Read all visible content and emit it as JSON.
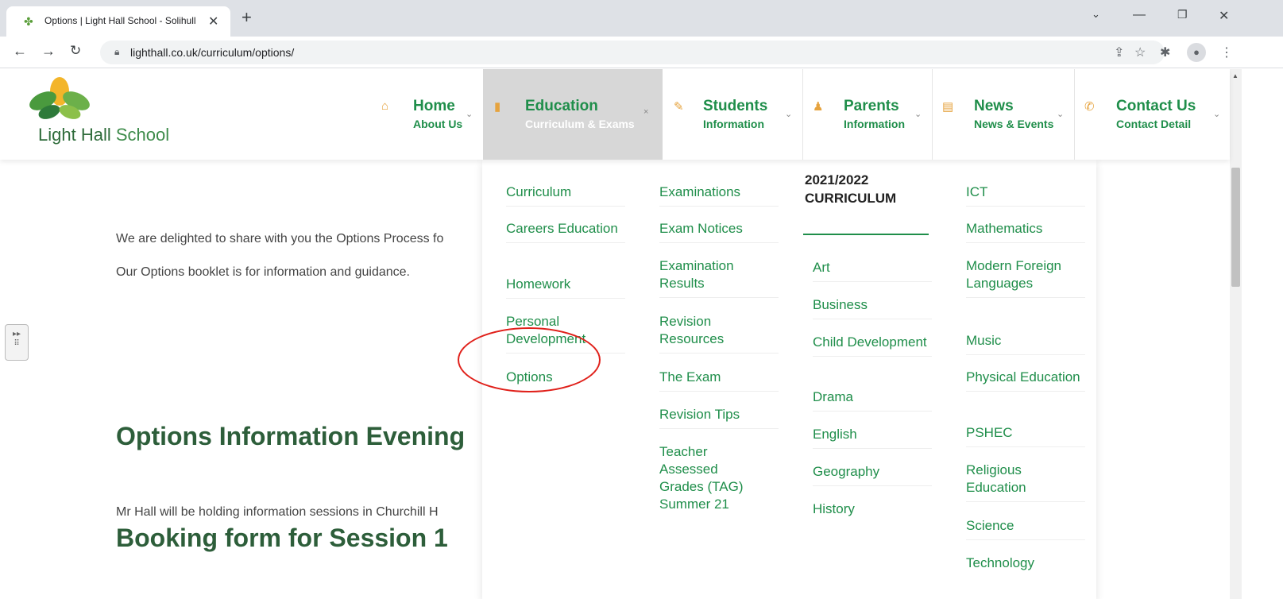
{
  "browser": {
    "tab_title": "Options | Light Hall School - Solihull",
    "url": "lighthall.co.uk/curriculum/options/"
  },
  "logo": {
    "light": "Light",
    "hall": " Hall ",
    "school": "School"
  },
  "nav": [
    {
      "title": "Home",
      "sub": "About Us",
      "icon": "home-icon"
    },
    {
      "title": "Education",
      "sub": "Curriculum & Exams",
      "icon": "book-icon"
    },
    {
      "title": "Students",
      "sub": "Information",
      "icon": "pencil-icon"
    },
    {
      "title": "Parents",
      "sub": "Information",
      "icon": "person-icon"
    },
    {
      "title": "News",
      "sub": "News & Events",
      "icon": "document-icon"
    },
    {
      "title": "Contact Us",
      "sub": "Contact Detail",
      "icon": "phone-icon"
    }
  ],
  "content": {
    "intro1": "We are delighted to share with you the Options Process fo",
    "intro2": "Our Options booklet is for information and guidance.",
    "heading1": "Options Information Evening",
    "para1": "Mr Hall will be holding information sessions in Churchill H",
    "heading2": "Booking form for Session 1"
  },
  "menu": {
    "col1": [
      "Curriculum",
      "Careers Education",
      "Homework",
      "Personal Development",
      "Options"
    ],
    "col2": [
      "Examinations",
      "Exam Notices",
      "Examination Results",
      "Revision Resources",
      "The Exam",
      "Revision Tips",
      "Teacher Assessed Grades (TAG) Summer 21"
    ],
    "col3_heading": "2021/2022 CURRICULUM",
    "col3": [
      "Art",
      "Business",
      "Child Development",
      "Drama",
      "English",
      "Geography",
      "History"
    ],
    "col4": [
      "ICT",
      "Mathematics",
      "Modern Foreign Languages",
      "Music",
      "Physical Education",
      "PSHEC",
      "Religious Education",
      "Science",
      "Technology"
    ]
  },
  "colors": {
    "brand_green": "#1f8e4a",
    "heading_green": "#2d5e3a",
    "highlight_red": "#e0201a"
  }
}
